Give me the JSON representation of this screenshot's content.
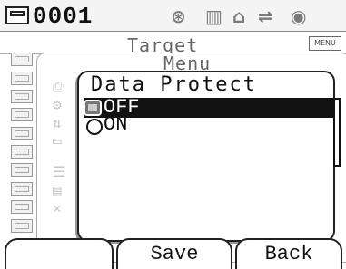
{
  "status": {
    "id": "0001",
    "icons": [
      "calibration-icon",
      "hdd-icon",
      "measure-icon",
      "network-icon",
      "target-icon"
    ]
  },
  "target_label": "Target",
  "menu_tag": "MENU",
  "menu": {
    "title": "Menu"
  },
  "dialog": {
    "title": "Data Protect",
    "options": [
      {
        "label": "OFF",
        "selected": true
      },
      {
        "label": "ON",
        "selected": false
      }
    ]
  },
  "buttons": {
    "left": "",
    "save": "Save",
    "back": "Back"
  }
}
